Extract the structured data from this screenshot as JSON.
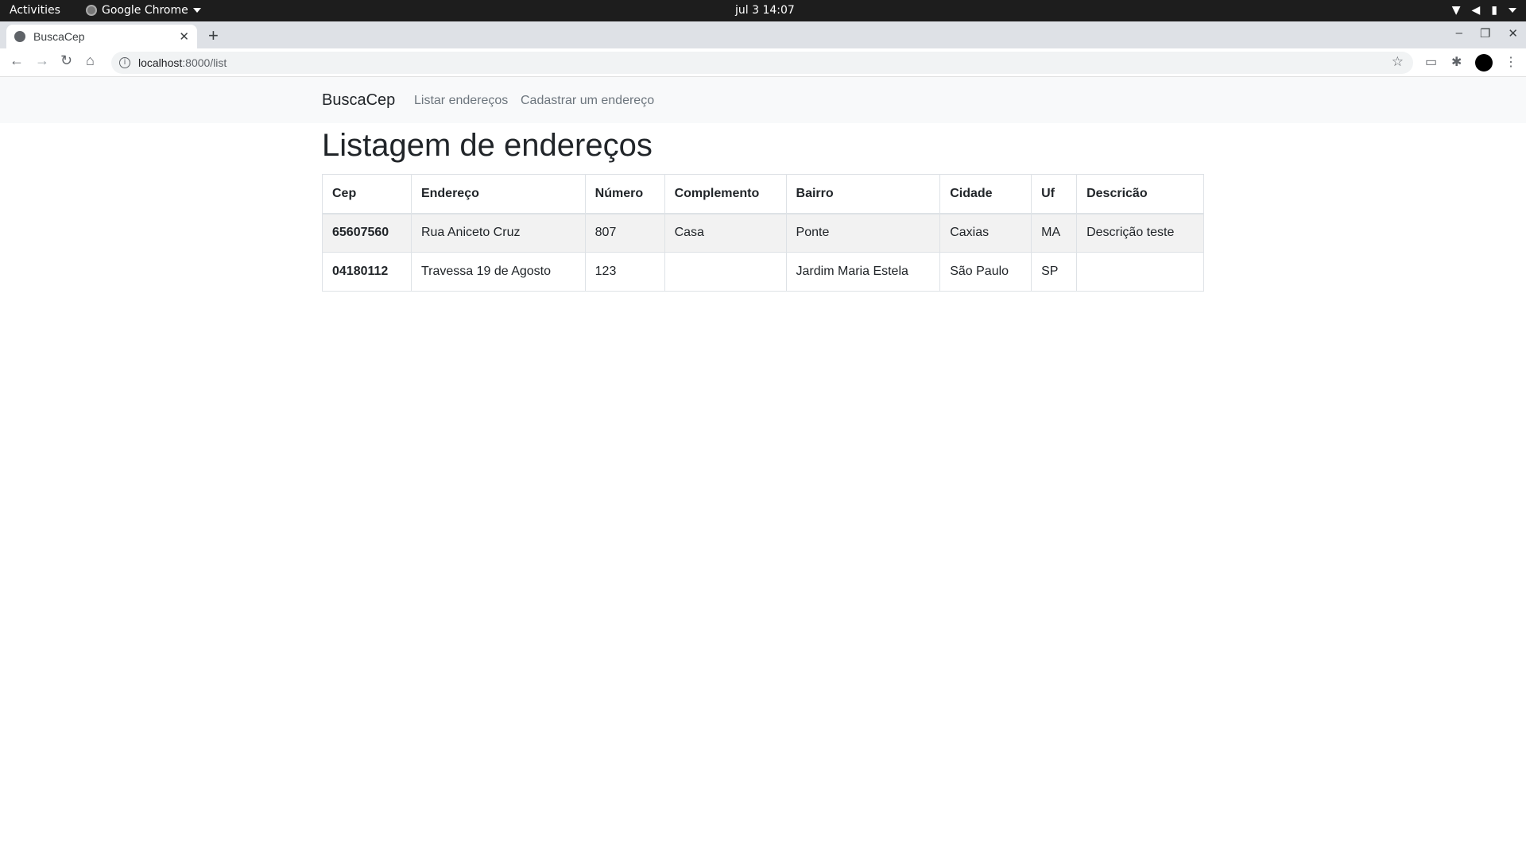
{
  "os": {
    "activities": "Activities",
    "app_name": "Google Chrome",
    "clock": "jul 3  14:07"
  },
  "browser": {
    "tab_title": "BuscaCep",
    "url_host": "localhost",
    "url_path": ":8000/list"
  },
  "navbar": {
    "brand": "BuscaCep",
    "links": [
      "Listar endereços",
      "Cadastrar um endereço"
    ]
  },
  "main": {
    "title": "Listagem de endereços",
    "columns": [
      "Cep",
      "Endereço",
      "Número",
      "Complemento",
      "Bairro",
      "Cidade",
      "Uf",
      "Descricão"
    ],
    "rows": [
      [
        "65607560",
        "Rua Aniceto Cruz",
        "807",
        "Casa",
        "Ponte",
        "Caxias",
        "MA",
        "Descrição teste"
      ],
      [
        "04180112",
        "Travessa 19 de Agosto",
        "123",
        "",
        "Jardim Maria Estela",
        "São Paulo",
        "SP",
        ""
      ]
    ]
  }
}
